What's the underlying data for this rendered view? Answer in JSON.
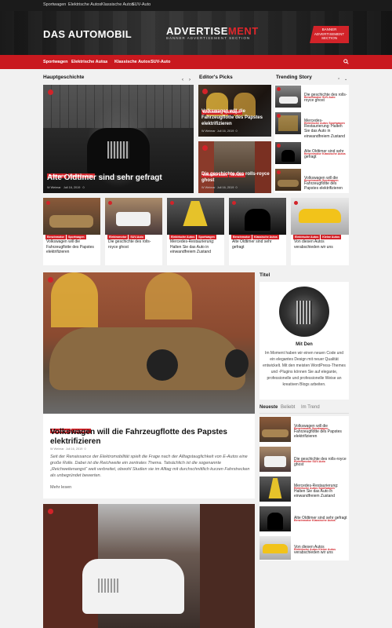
{
  "topbar": {
    "links": [
      "Sportwagen",
      "Elektrische Autos",
      "Klassische Autos",
      "SUV-Auto"
    ]
  },
  "header": {
    "site_title": "DAS AUTOMOBIL",
    "ad_main_white": "ADVERTISE",
    "ad_main_red": "MENT",
    "ad_sub": "BANNER ADVERTISEMENT SECTION",
    "ad_badge_line1": "BANNER",
    "ad_badge_line2": "ADVERTISEMENT",
    "ad_badge_line3": "SECTION"
  },
  "nav": {
    "items": [
      "Sportwagen",
      "Elektrische Autos",
      "Klassische Autos",
      "SUV-Auto"
    ]
  },
  "sections": {
    "main": "Hauptgeschichte",
    "editors": "Editor's Picks",
    "trending": "Trending Story"
  },
  "main_story": {
    "tags": [
      "Benzinmotor",
      "Klassische Autos"
    ],
    "title": "Alte Oldtimer sind sehr gefragt",
    "author": "W Weimar",
    "date": "Juli 16, 2019",
    "comments": "0"
  },
  "editors_picks": [
    {
      "tags": [
        "Benzinmotor",
        "Sportwagen"
      ],
      "title": "Volkswagen will die Fahrzeugflotte des Papstes elektrifizieren",
      "author": "W Weimar",
      "date": "Juli 16, 2019",
      "comments": "0"
    },
    {
      "tags": [
        "Elektrische Autos",
        "SUV-Auto"
      ],
      "title": "Die geschichte des rolls-royce ghost",
      "author": "W Weimar",
      "date": "Juli 16, 2019",
      "comments": "0"
    }
  ],
  "trending": [
    {
      "tags": [
        "Benzinmotor",
        "SUV-Auto"
      ],
      "title": "Die geschichte des rolls-royce ghost"
    },
    {
      "tags": [
        "Elektrische Autos",
        "Sportwagen"
      ],
      "title": "Mercedes-Restaurierung: Halten Sie das Auto in einwandfreiem Zustand"
    },
    {
      "tags": [
        "Benzinmotor",
        "Klassische Autos"
      ],
      "title": "Alte Oldtimer sind sehr gefragt"
    },
    {
      "tags": [
        "Benzinmotor",
        "Sportwagen"
      ],
      "title": "Volkswagen will die Fahrzeugflotte des Papstes elektrifizieren"
    }
  ],
  "cards": [
    {
      "tags": [
        "Benzinmotor",
        "Sportwagen"
      ],
      "title": "Volkswagen will die Fahrzeugflotte des Papstes elektrifizieren"
    },
    {
      "tags": [
        "Elektromotor",
        "SUV-Auto"
      ],
      "title": "Die geschichte des rolls-royce ghost"
    },
    {
      "tags": [
        "Elektrische Autos",
        "Sportwagen"
      ],
      "title": "Mercedes-Restaurierung: Halten Sie das Auto in einwandfreiem Zustand"
    },
    {
      "tags": [
        "Benzinmotor",
        "Klassische Autos"
      ],
      "title": "Alte Oldtimer sind sehr gefragt"
    },
    {
      "tags": [
        "Elektrische Autos",
        "Kleine Autos"
      ],
      "title": "Von diesen Autos verabschieden wir uns"
    }
  ],
  "featured": {
    "tags": [
      "Benzinmotor",
      "Sportwagen"
    ],
    "title": "Volkswagen will die Fahrzeugflotte des Papstes elektrifizieren",
    "author": "W Weimar",
    "date": "Juli 16, 2019",
    "comments": "0",
    "excerpt": "Seit der Renaissance der Elektromobilität spielt die Frage nach der Alltagstauglichkeit von E-Autos eine große Rolle. Dabei ist die Reichweite ein zentrales Thema. Tatsächlich ist die sogenannte „Reichweitenangst“ weit verbreitet, obwohl Studien sie im Alltag mit durchschnittlich kurzen Fahrstrecken als unbegründet bewerten.",
    "read_more": "Mehr lesen"
  },
  "sidebar": {
    "widget_title": "Titel",
    "author_name": "Mit Den",
    "author_bio": "Im Moment haben wir einen neuen Code und ein elegantes Design mit neuer Qualität entwickelt. Mit den meisten WordPress-Themes und -Plugins können Sie auf elegante, professionelle und professionelle Weise an kreativen Blogs arbeiten.",
    "tabs": [
      "Neueste",
      "Beliebt",
      "Im Trend"
    ],
    "latest": [
      {
        "tags": [
          "Benzinmotor",
          "Sportwagen"
        ],
        "title": "Volkswagen will die Fahrzeugflotte des Papstes elektrifizieren"
      },
      {
        "tags": [
          "Elektromotor",
          "SUV-Auto"
        ],
        "title": "Die geschichte des rolls-royce ghost"
      },
      {
        "tags": [
          "Elektrische Autos",
          "Sportwagen"
        ],
        "title": "Mercedes-Restaurierung: Halten Sie das Auto in einwandfreiem Zustand"
      },
      {
        "tags": [
          "Benzinmotor",
          "Klassische Autos"
        ],
        "title": "Alte Oldtimer sind sehr gefragt"
      },
      {
        "tags": [
          "Elektrische Autos",
          "Kleine Autos"
        ],
        "title": "Von diesen Autos verabschieden wir uns"
      }
    ]
  },
  "colors": {
    "accent": "#d22329",
    "nav": "#c9191f",
    "dark": "#1b1b1b"
  }
}
